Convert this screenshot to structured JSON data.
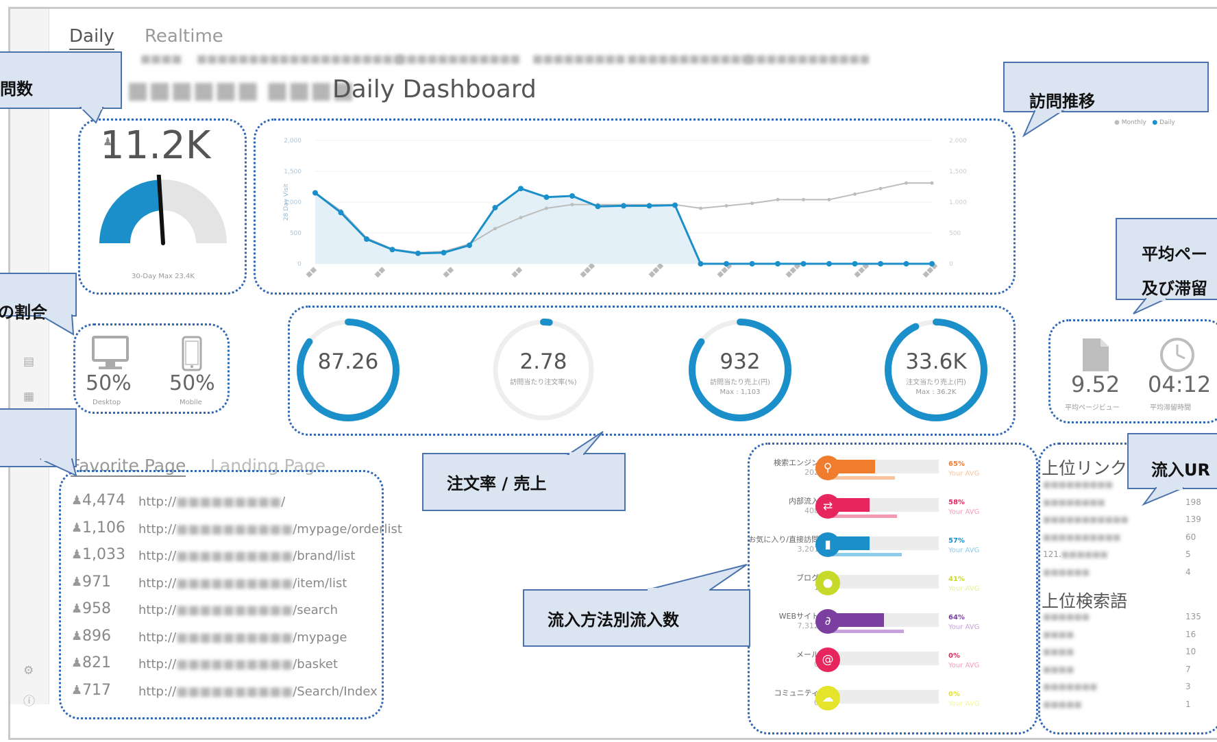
{
  "tabs": {
    "daily": "Daily",
    "realtime": "Realtime"
  },
  "subtabs": [
    "■■■■",
    "■■■■■■■■",
    "■■■■■■■■■■■■",
    "■■■■■■■■■■■■",
    "■■■■■■■■■",
    "■■■■■■■■■■■■",
    "■■■■■■■■■■■■"
  ],
  "dashboard": {
    "title_prefix": "■■■■■■ ■■■■",
    "title": "Daily Dashboard"
  },
  "visits": {
    "value": "11.2K",
    "max_label": "30-Day Max 23.4K",
    "gauge_fraction": 0.48
  },
  "trend": {
    "legend": [
      "Monthly",
      "Daily"
    ],
    "colors": {
      "daily": "#1a8fc9",
      "monthly": "#bdbdbd"
    },
    "chart_data": {
      "type": "line",
      "y_ticks": [
        "2,000",
        "1,500",
        "1,000",
        "500",
        "0"
      ],
      "y_right_ticks": [
        "2,000",
        "1,500",
        "1,000",
        "500",
        "0"
      ],
      "ylabel": "28 Day Visit",
      "ylim": [
        0,
        2000
      ],
      "x_ticks": [
        "■■",
        "■■",
        "■■",
        "■■",
        "■■■",
        "■■■",
        "■■■",
        "■■■",
        "■■■",
        "■■■"
      ],
      "series": [
        {
          "name": "Daily",
          "values": [
            1150,
            830,
            400,
            230,
            170,
            180,
            300,
            910,
            1220,
            1080,
            1100,
            930,
            940,
            940,
            950,
            0,
            0,
            0,
            0,
            0,
            0,
            0,
            0,
            0,
            0
          ]
        },
        {
          "name": "Monthly",
          "values": [
            1150,
            860,
            420,
            240,
            180,
            200,
            320,
            570,
            750,
            900,
            960,
            960,
            960,
            960,
            960,
            900,
            940,
            980,
            1040,
            1040,
            1040,
            1130,
            1220,
            1310,
            1310
          ]
        }
      ]
    }
  },
  "device": {
    "desktop_pct": "50%",
    "desktop_label": "Desktop",
    "mobile_pct": "50%",
    "mobile_label": "Mobile"
  },
  "rings": [
    {
      "value": "87.26",
      "sub1": "",
      "sub2": "",
      "fraction": 0.85
    },
    {
      "value": "2.78",
      "sub1": "訪問当たり注文率(%)",
      "sub2": "",
      "fraction": 0.02
    },
    {
      "value": "932",
      "sub1": "訪問当たり売上(円)",
      "sub2": "Max : 1,103",
      "fraction": 0.85
    },
    {
      "value": "33.6K",
      "sub1": "注文当たり売上(円)",
      "sub2": "Max : 36.2K",
      "fraction": 0.93
    }
  ],
  "page_stats": {
    "pv_value": "9.52",
    "pv_label": "平均ページビュー",
    "time_value": "04:12",
    "time_label": "平均滞留時間"
  },
  "pages": {
    "favorite_tab": "Favorite Page",
    "landing_tab": "Landing Page",
    "rows": [
      {
        "count": "4,474",
        "url": "http://■■■■■■■■■/"
      },
      {
        "count": "1,106",
        "url": "http://■■■■■■■■■■/mypage/orderlist"
      },
      {
        "count": "1,033",
        "url": "http://■■■■■■■■■■/brand/list"
      },
      {
        "count": "971",
        "url": "http://■■■■■■■■■■/item/list"
      },
      {
        "count": "958",
        "url": "http://■■■■■■■■■■/search"
      },
      {
        "count": "896",
        "url": "http://■■■■■■■■■■/mypage"
      },
      {
        "count": "821",
        "url": "http://■■■■■■■■■■/basket"
      },
      {
        "count": "717",
        "url": "http://■■■■■■■■■■/Search/Index"
      }
    ]
  },
  "channels": [
    {
      "name": "検索エンジン",
      "count": "202",
      "pct": "65%",
      "avg": "Your AVG",
      "color": "#f07c2e",
      "light": "#f9c39d",
      "fill": 0.42,
      "avg_fill": 0.6,
      "icon": "search-icon",
      "glyph": "⚲"
    },
    {
      "name": "内部流入",
      "count": "408",
      "pct": "58%",
      "avg": "Your AVG",
      "color": "#e8265e",
      "light": "#f59ab4",
      "fill": 0.37,
      "avg_fill": 0.62,
      "icon": "transfer-icon",
      "glyph": "⇄"
    },
    {
      "name": "お気に入り/直接訪問",
      "count": "3,201",
      "pct": "57%",
      "avg": "Your AVG",
      "color": "#1a8fc9",
      "light": "#8ccbea",
      "fill": 0.37,
      "avg_fill": 0.66,
      "icon": "bookmark-icon",
      "glyph": "▮"
    },
    {
      "name": "ブログ",
      "count": "1",
      "pct": "41%",
      "avg": "Your AVG",
      "color": "#c7d92b",
      "light": "#e6ef9d",
      "fill": 0.06,
      "avg_fill": 0.0,
      "icon": "chat-bubble-icon",
      "glyph": "●"
    },
    {
      "name": "WEBサイト",
      "count": "7,312",
      "pct": "64%",
      "avg": "Your AVG",
      "color": "#7b3fa0",
      "light": "#c6a1dc",
      "fill": 0.5,
      "avg_fill": 0.68,
      "icon": "link-icon",
      "glyph": "∂"
    },
    {
      "name": "メール",
      "count": "0",
      "pct": "0%",
      "avg": "Your AVG",
      "color": "#e8265e",
      "light": "#f59ab4",
      "fill": 0.0,
      "avg_fill": 0.0,
      "icon": "at-icon",
      "glyph": "@"
    },
    {
      "name": "コミュニティ",
      "count": "0",
      "pct": "0%",
      "avg": "Your AVG",
      "color": "#e4e52b",
      "light": "#f3f39c",
      "fill": 0.0,
      "avg_fill": 0.0,
      "icon": "cloud-icon",
      "glyph": "☁"
    }
  ],
  "referrers": {
    "title": "上位リンク",
    "rows": [
      {
        "name": "■■■■■■■■■",
        "value": ""
      },
      {
        "name": "■■■■■■■■",
        "value": "198"
      },
      {
        "name": "■■■■■■■■■■■",
        "value": "139"
      },
      {
        "name": "■■■■■■■■■■",
        "value": "60"
      },
      {
        "name": "121.■■■■■■",
        "value": "5"
      },
      {
        "name": "■■■■■■",
        "value": "4"
      }
    ]
  },
  "keywords": {
    "title": "上位検索語",
    "rows": [
      {
        "name": "■■■■■■",
        "value": "135"
      },
      {
        "name": "■■■■",
        "value": "16"
      },
      {
        "name": "■■■■",
        "value": "10"
      },
      {
        "name": "■■■■",
        "value": "7"
      },
      {
        "name": "■■■■■■■",
        "value": "3"
      },
      {
        "name": "■■■■■",
        "value": "1"
      }
    ]
  },
  "callouts": {
    "visits": "問数",
    "trend": "訪問推移",
    "ratio": "の割合",
    "pageview_line1": "平均ペー",
    "pageview_line2": "及び滞留",
    "orders": "注文率 / 売上",
    "channels": "流入方法別流入数",
    "inflow_url": "流入UR"
  }
}
